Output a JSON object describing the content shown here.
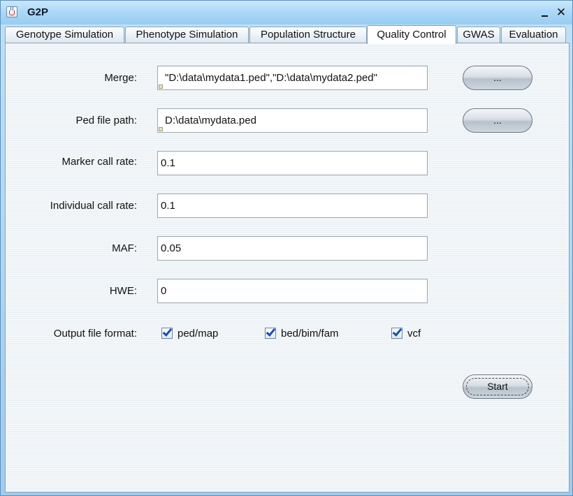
{
  "window": {
    "title": "G2P"
  },
  "tabs": [
    {
      "label": "Genotype Simulation"
    },
    {
      "label": "Phenotype Simulation"
    },
    {
      "label": "Population Structure"
    },
    {
      "label": "Quality Control",
      "active": true
    },
    {
      "label": "GWAS"
    },
    {
      "label": "Evaluation"
    }
  ],
  "form": {
    "merge": {
      "label": "Merge:",
      "value": "\"D:\\data\\mydata1.ped\",\"D:\\data\\mydata2.ped\"",
      "browse_label": "..."
    },
    "ped_path": {
      "label": "Ped file path:",
      "value": "D:\\data\\mydata.ped",
      "browse_label": "..."
    },
    "marker_call_rate": {
      "label": "Marker call rate:",
      "value": "0.1"
    },
    "individual_call_rate": {
      "label": "Individual call rate:",
      "value": "0.1"
    },
    "maf": {
      "label": "MAF:",
      "value": "0.05"
    },
    "hwe": {
      "label": "HWE:",
      "value": "0"
    },
    "output_format": {
      "label": "Output file format:",
      "options": [
        {
          "label": "ped/map",
          "checked": true
        },
        {
          "label": "bed/bim/fam",
          "checked": true
        },
        {
          "label": "vcf",
          "checked": true
        }
      ]
    },
    "start_label": "Start"
  },
  "icons": {
    "app": "java-cup-icon",
    "minimize": "minimize-icon",
    "close": "close-icon"
  },
  "colors": {
    "title_bar": "#aad7f6",
    "panel": "#edf2f6",
    "check": "#1a4fb0"
  }
}
